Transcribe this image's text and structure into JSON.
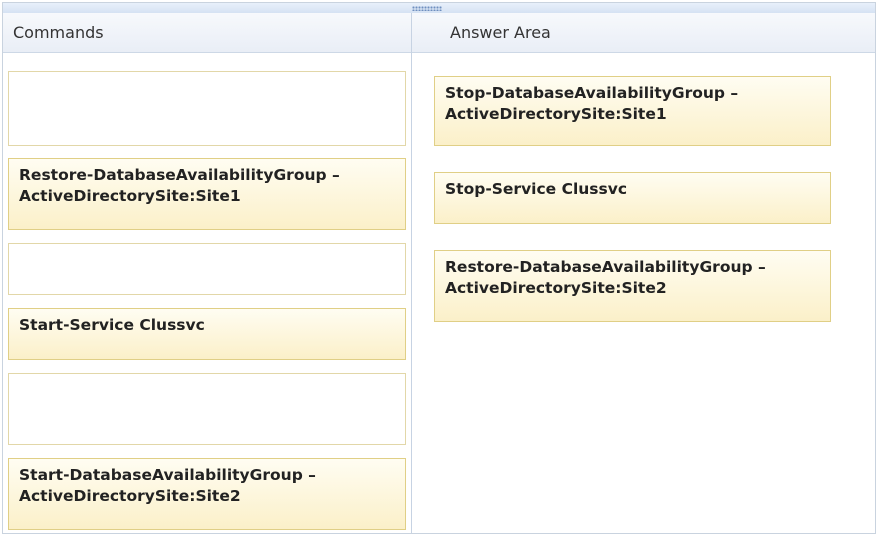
{
  "headers": {
    "commands": "Commands",
    "answer_area": "Answer Area"
  },
  "commands": {
    "restore_site1": "Restore-DatabaseAvailabilityGroup –\nActiveDirectorySite:Site1",
    "start_service": "Start-Service Clussvc",
    "start_dag_site2": "Start-DatabaseAvailabilityGroup –\nActiveDirectorySite:Site2"
  },
  "answers": {
    "stop_dag_site1": "Stop-DatabaseAvailabilityGroup –\nActiveDirectorySite:Site1",
    "stop_service": "Stop-Service Clussvc",
    "restore_site2": "Restore-DatabaseAvailabilityGroup –\nActiveDirectorySite:Site2"
  },
  "colors": {
    "item_fill": "#fbf0c9",
    "item_border": "#e0cf86",
    "header_fill": "#e9eef6"
  }
}
